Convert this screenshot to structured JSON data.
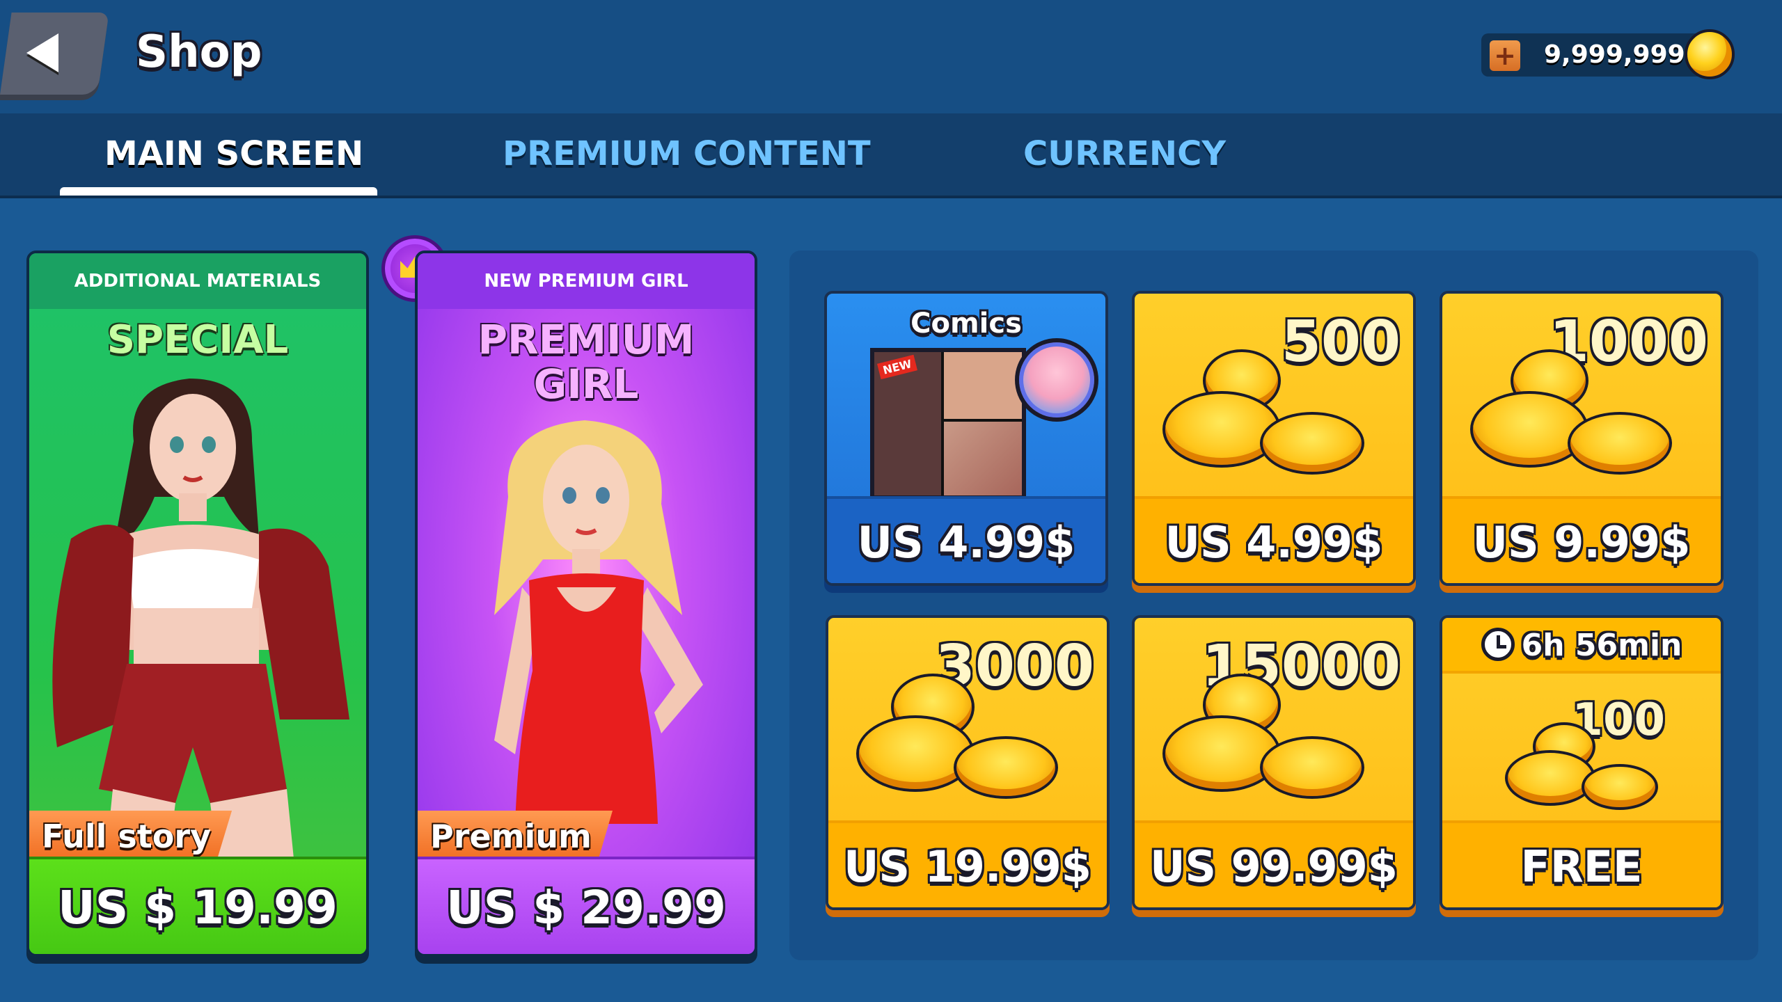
{
  "header": {
    "title": "Shop",
    "currency_amount": "9,999,999",
    "plus_label": "+"
  },
  "tabs": [
    {
      "label": "MAIN SCREEN",
      "active": true
    },
    {
      "label": "PREMIUM CONTENT",
      "active": false
    },
    {
      "label": "CURRENCY",
      "active": false
    }
  ],
  "special_card": {
    "header": "ADDITIONAL MATERIALS",
    "title": "SPECIAL",
    "ribbon": "Full story",
    "price": "US $ 19.99"
  },
  "premium_card": {
    "header": "NEW PREMIUM GIRL",
    "title_line1": "PREMIUM",
    "title_line2": "GIRL",
    "ribbon": "Premium",
    "price": "US $ 29.99"
  },
  "tiles": {
    "comics": {
      "title": "Comics",
      "tag": "NEW",
      "price": "US 4.99$"
    },
    "coins_500": {
      "amount": "500",
      "price": "US 4.99$"
    },
    "coins_1000": {
      "amount": "1000",
      "price": "US 9.99$"
    },
    "coins_3000": {
      "amount": "3000",
      "price": "US 19.99$"
    },
    "coins_15000": {
      "amount": "15000",
      "price": "US 99.99$"
    },
    "free": {
      "timer": "6h 56min",
      "amount": "100",
      "price": "FREE"
    }
  },
  "colors": {
    "background": "#1a5a95",
    "special_green": "#26c24b",
    "premium_purple": "#a842ef",
    "gold": "#ffbb14",
    "comics_blue": "#1f6fd3"
  }
}
